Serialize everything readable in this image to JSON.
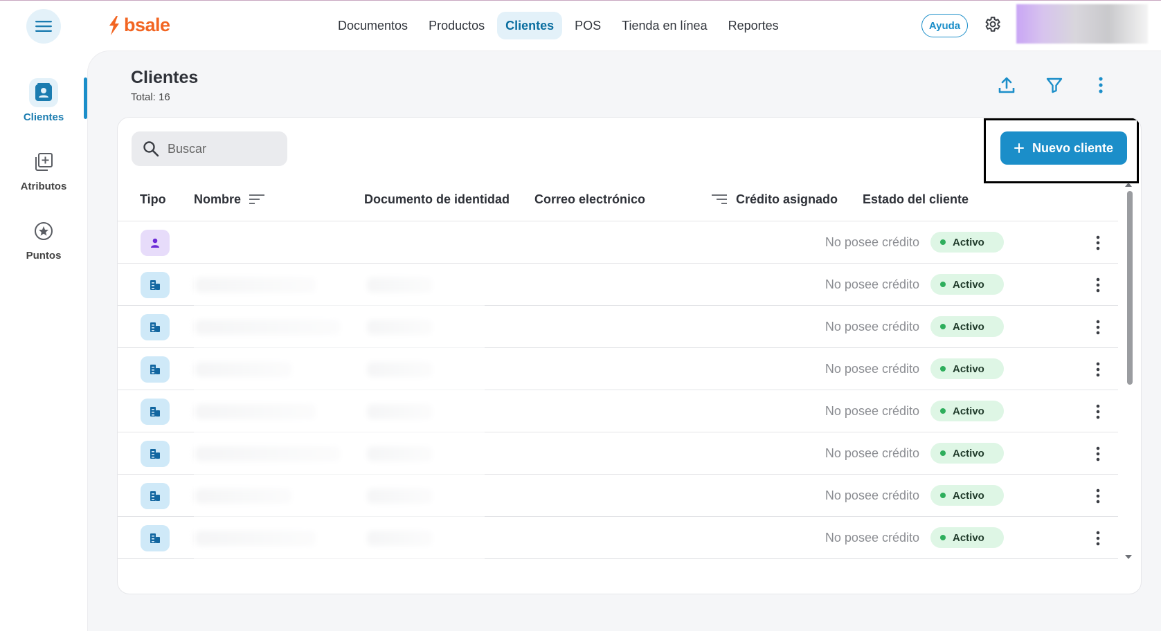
{
  "brand": {
    "name": "bsale",
    "color": "#f26522"
  },
  "nav": {
    "items": [
      {
        "label": "Documentos",
        "active": false
      },
      {
        "label": "Productos",
        "active": false
      },
      {
        "label": "Clientes",
        "active": true
      },
      {
        "label": "POS",
        "active": false
      },
      {
        "label": "Tienda en línea",
        "active": false
      },
      {
        "label": "Reportes",
        "active": false
      }
    ],
    "help_label": "Ayuda"
  },
  "rail": {
    "items": [
      {
        "label": "Clientes",
        "icon": "contact-card-icon",
        "active": true
      },
      {
        "label": "Atributos",
        "icon": "add-box-icon",
        "active": false
      },
      {
        "label": "Puntos",
        "icon": "star-circle-icon",
        "active": false
      }
    ]
  },
  "page": {
    "title": "Clientes",
    "total": "Total: 16"
  },
  "toolbar": {
    "search_placeholder": "Buscar",
    "new_client_label": "Nuevo cliente"
  },
  "table": {
    "columns": [
      "Tipo",
      "Nombre",
      "Documento de identidad",
      "Correo electrónico",
      "Crédito asignado",
      "Estado del cliente"
    ],
    "rows": [
      {
        "type": "person",
        "credit": "No posee crédito",
        "status": "Activo"
      },
      {
        "type": "company",
        "credit": "No posee crédito",
        "status": "Activo"
      },
      {
        "type": "company",
        "credit": "No posee crédito",
        "status": "Activo"
      },
      {
        "type": "company",
        "credit": "No posee crédito",
        "status": "Activo"
      },
      {
        "type": "company",
        "credit": "No posee crédito",
        "status": "Activo"
      },
      {
        "type": "company",
        "credit": "No posee crédito",
        "status": "Activo"
      },
      {
        "type": "company",
        "credit": "No posee crédito",
        "status": "Activo"
      },
      {
        "type": "company",
        "credit": "No posee crédito",
        "status": "Activo"
      }
    ]
  },
  "colors": {
    "accent": "#1b8ec9",
    "status_active": "#2eae5c",
    "status_bg": "#def6e5"
  }
}
